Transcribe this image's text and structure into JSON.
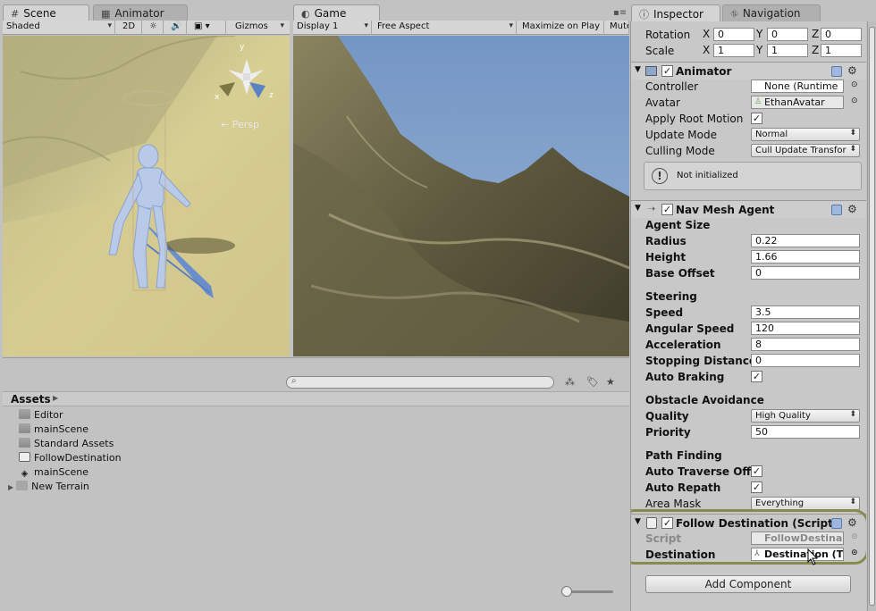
{
  "tabs": {
    "scene": "Scene",
    "animator": "Animator",
    "game": "Game",
    "inspector": "Inspector",
    "navigation": "Navigation"
  },
  "scene_toolbar": {
    "shading": "Shaded",
    "mode_2d": "2D",
    "gizmos": "Gizmos",
    "persp": "← Persp",
    "axis_y": "y",
    "axis_x": "x",
    "axis_z": "z"
  },
  "game_toolbar": {
    "display": "Display 1",
    "aspect": "Free Aspect",
    "maximize": "Maximize on Play",
    "mute": "Mute"
  },
  "project": {
    "breadcrumb": "Assets",
    "items": [
      {
        "label": "Editor",
        "type": "folder"
      },
      {
        "label": "mainScene",
        "type": "folder"
      },
      {
        "label": "Standard Assets",
        "type": "folder"
      },
      {
        "label": "FollowDestination",
        "type": "script"
      },
      {
        "label": "mainScene",
        "type": "scene"
      },
      {
        "label": "New Terrain",
        "type": "terrain"
      }
    ]
  },
  "inspector": {
    "transform": {
      "rotation_label": "Rotation",
      "scale_label": "Scale",
      "rotation": {
        "x": "0",
        "y": "0",
        "z": "0"
      },
      "scale": {
        "x": "1",
        "y": "1",
        "z": "1"
      },
      "x": "X",
      "y": "Y",
      "z": "Z"
    },
    "animator": {
      "title": "Animator",
      "controller_label": "Controller",
      "controller_value": "None (Runtime",
      "avatar_label": "Avatar",
      "avatar_value": "EthanAvatar",
      "root_motion_label": "Apply Root Motion",
      "update_mode_label": "Update Mode",
      "update_mode_value": "Normal",
      "culling_label": "Culling Mode",
      "culling_value": "Cull Update Transfor",
      "status": "Not initialized"
    },
    "nav": {
      "title": "Nav Mesh Agent",
      "agent_size": "Agent Size",
      "radius_label": "Radius",
      "radius": "0.22",
      "height_label": "Height",
      "height": "1.66",
      "base_offset_label": "Base Offset",
      "base_offset": "0",
      "steering": "Steering",
      "speed_label": "Speed",
      "speed": "3.5",
      "angular_label": "Angular Speed",
      "angular": "120",
      "accel_label": "Acceleration",
      "accel": "8",
      "stopping_label": "Stopping Distance",
      "stopping": "0",
      "braking_label": "Auto Braking",
      "obstacle": "Obstacle Avoidance",
      "quality_label": "Quality",
      "quality": "High Quality",
      "priority_label": "Priority",
      "priority": "50",
      "path": "Path Finding",
      "traverse_label": "Auto Traverse Off",
      "repath_label": "Auto Repath",
      "area_label": "Area Mask",
      "area": "Everything"
    },
    "follow": {
      "title": "Follow Destination (Script)",
      "script_label": "Script",
      "script_value": "FollowDestina",
      "dest_label": "Destination",
      "dest_value": "Destination (T"
    },
    "add_component": "Add Component"
  },
  "colors": {
    "highlight_ring": "#8a8a50",
    "sky": "#7c9cc6"
  }
}
